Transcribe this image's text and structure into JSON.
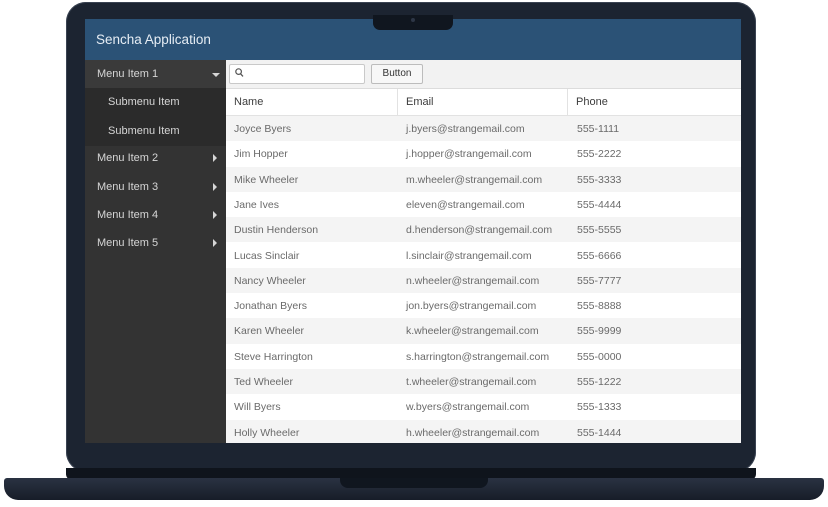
{
  "app": {
    "title": "Sencha Application"
  },
  "sidebar": {
    "items": [
      {
        "label": "Menu Item 1",
        "expanded": true,
        "submenu": [
          {
            "label": "Submenu Item"
          },
          {
            "label": "Submenu Item"
          }
        ]
      },
      {
        "label": "Menu Item 2"
      },
      {
        "label": "Menu Item 3"
      },
      {
        "label": "Menu Item 4"
      },
      {
        "label": "Menu Item 5"
      }
    ]
  },
  "toolbar": {
    "search": {
      "value": "",
      "placeholder": "",
      "icon": "search-icon"
    },
    "button_label": "Button"
  },
  "grid": {
    "columns": [
      "Name",
      "Email",
      "Phone"
    ],
    "rows": [
      [
        "Joyce Byers",
        "j.byers@strangemail.com",
        "555-1111"
      ],
      [
        "Jim Hopper",
        "j.hopper@strangemail.com",
        "555-2222"
      ],
      [
        "Mike Wheeler",
        "m.wheeler@strangemail.com",
        "555-3333"
      ],
      [
        "Jane Ives",
        "eleven@strangemail.com",
        "555-4444"
      ],
      [
        "Dustin Henderson",
        "d.henderson@strangemail.com",
        "555-5555"
      ],
      [
        "Lucas Sinclair",
        "l.sinclair@strangemail.com",
        "555-6666"
      ],
      [
        "Nancy Wheeler",
        "n.wheeler@strangemail.com",
        "555-7777"
      ],
      [
        "Jonathan Byers",
        "jon.byers@strangemail.com",
        "555-8888"
      ],
      [
        "Karen Wheeler",
        "k.wheeler@strangemail.com",
        "555-9999"
      ],
      [
        "Steve Harrington",
        "s.harrington@strangemail.com",
        "555-0000"
      ],
      [
        "Ted Wheeler",
        "t.wheeler@strangemail.com",
        "555-1222"
      ],
      [
        "Will Byers",
        "w.byers@strangemail.com",
        "555-1333"
      ],
      [
        "Holly Wheeler",
        "h.wheeler@strangemail.com",
        "555-1444"
      ]
    ]
  },
  "colors": {
    "titlebar": "#2b5276",
    "sidebar": "#333333",
    "laptop_frame": "#1c2431"
  }
}
